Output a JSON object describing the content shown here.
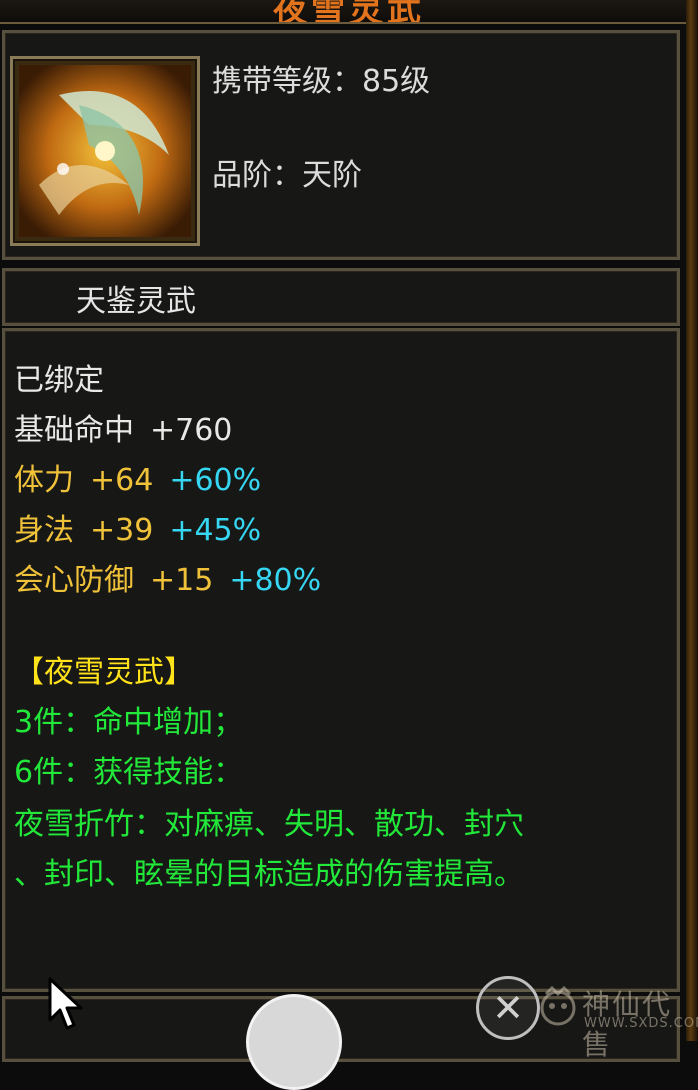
{
  "header": {
    "title": "夜雪灵武"
  },
  "item": {
    "icon": "weapon-icon",
    "level": {
      "label": "携带等级：",
      "value": "85级"
    },
    "grade": {
      "label": "品阶：",
      "value": "天阶"
    },
    "name": "天鉴灵武"
  },
  "stats": {
    "bound": "已绑定",
    "rows": [
      {
        "name": "基础命中",
        "base": "+760",
        "bonus": ""
      },
      {
        "name": "体力",
        "base": "+64",
        "bonus": "+60%"
      },
      {
        "name": "身法",
        "base": "+39",
        "bonus": "+45%"
      },
      {
        "name": "会心防御",
        "base": "+15",
        "bonus": "+80%"
      }
    ]
  },
  "set": {
    "title": "【夜雪灵武】",
    "bonus3": "3件：命中增加；",
    "bonus6": "6件：获得技能：",
    "skill_line1": "夜雪折竹：对麻痹、失明、散功、封穴",
    "skill_line2": "、封印、眩晕的目标造成的伤害提高。"
  },
  "overlay": {
    "close_icon": "close-icon",
    "home_icon": "home-button",
    "watermark_main": "神仙代售",
    "watermark_url": "WWW.SXDS.COM"
  },
  "colors": {
    "base_stat": "#f0c23a",
    "bonus_stat": "#35d7f2",
    "set_title": "#ffe21a",
    "set_effect": "#22e83a"
  }
}
